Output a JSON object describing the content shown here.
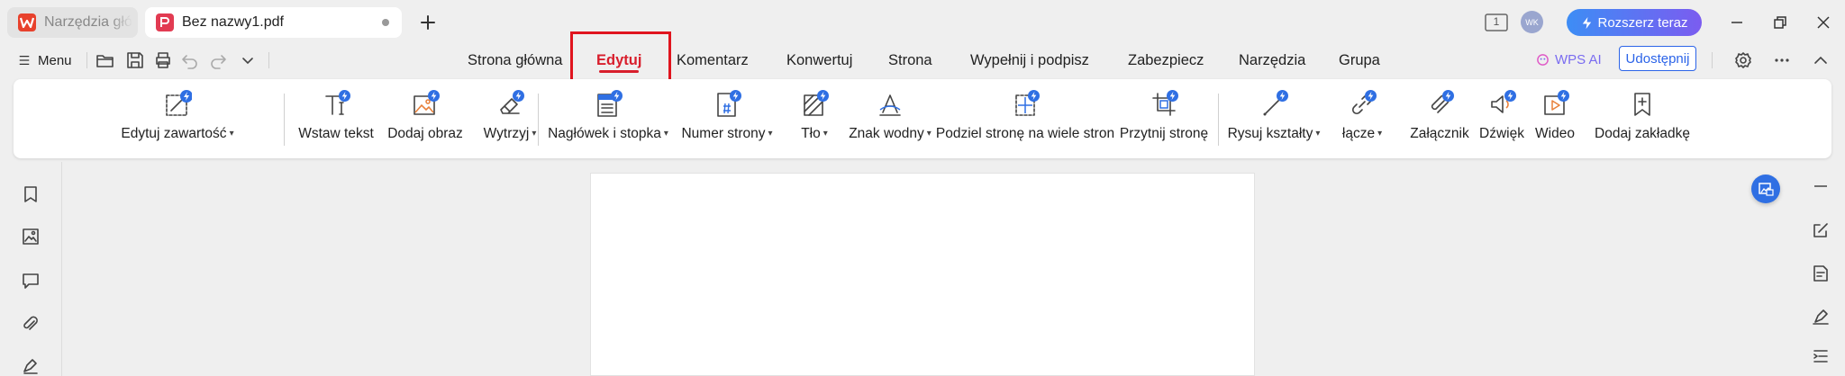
{
  "tabs": {
    "tools_label": "Narzędzia głó",
    "file_label": "Bez nazwy1.pdf"
  },
  "header": {
    "badge_number": "1",
    "avatar_initials": "WK",
    "upgrade_label": "Rozszerz teraz"
  },
  "menu": {
    "menu_label": "Menu"
  },
  "ribbon_tabs": [
    {
      "label": "Strona główna"
    },
    {
      "label": "Edytuj",
      "active": true
    },
    {
      "label": "Komentarz"
    },
    {
      "label": "Konwertuj"
    },
    {
      "label": "Strona"
    },
    {
      "label": "Wypełnij i podpisz"
    },
    {
      "label": "Zabezpiecz"
    },
    {
      "label": "Narzędzia"
    },
    {
      "label": "Grupa"
    }
  ],
  "ai": {
    "label": "WPS AI"
  },
  "share": {
    "label": "Udostępnij"
  },
  "tools": [
    {
      "label": "Edytuj zawartość",
      "dropdown": true,
      "icon": "edit-content-icon"
    },
    {
      "label": "Wstaw tekst",
      "icon": "insert-text-icon"
    },
    {
      "label": "Dodaj obraz",
      "icon": "add-image-icon"
    },
    {
      "label": "Wytrzyj",
      "dropdown": true,
      "icon": "eraser-icon"
    },
    {
      "label": "Nagłówek i stopka",
      "dropdown": true,
      "icon": "header-footer-icon"
    },
    {
      "label": "Numer strony",
      "dropdown": true,
      "icon": "page-number-icon"
    },
    {
      "label": "Tło",
      "dropdown": true,
      "icon": "background-icon"
    },
    {
      "label": "Znak wodny",
      "dropdown": true,
      "icon": "watermark-icon"
    },
    {
      "label": "Podziel stronę na wiele stron",
      "icon": "split-page-icon"
    },
    {
      "label": "Przytnij stronę",
      "icon": "crop-page-icon"
    },
    {
      "label": "Rysuj kształty",
      "dropdown": true,
      "icon": "draw-shapes-icon"
    },
    {
      "label": "łącze",
      "dropdown": true,
      "icon": "link-icon"
    },
    {
      "label": "Załącznik",
      "icon": "attachment-icon"
    },
    {
      "label": "Dźwięk",
      "icon": "sound-icon"
    },
    {
      "label": "Wideo",
      "icon": "video-icon"
    },
    {
      "label": "Dodaj zakładkę",
      "icon": "add-bookmark-icon"
    }
  ],
  "colors": {
    "accent_red": "#d81e2c",
    "highlight_box": "#e0141e",
    "share_blue": "#2c64e8",
    "spark_blue": "#2f6fe3"
  }
}
